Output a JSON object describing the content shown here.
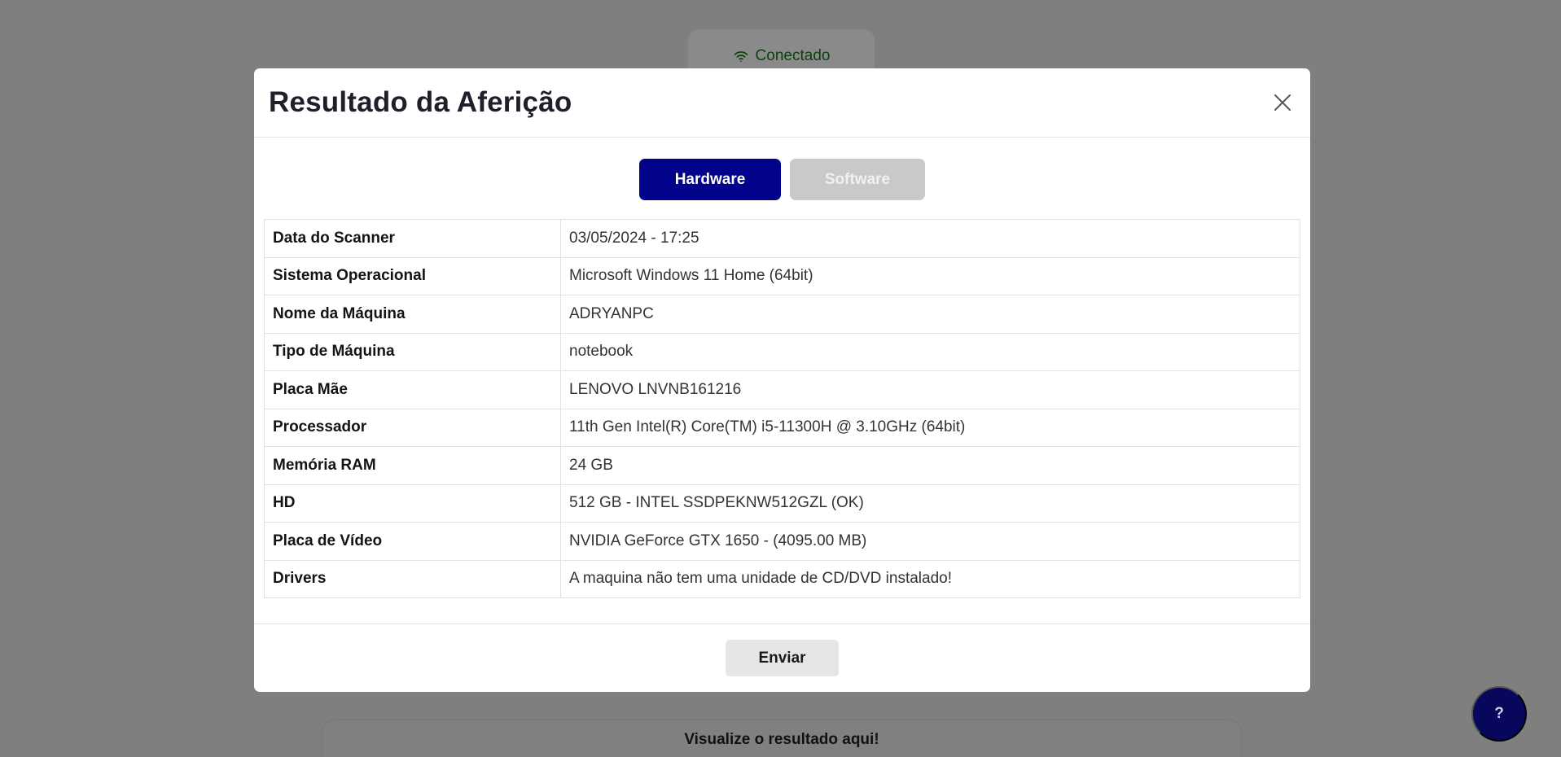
{
  "background": {
    "status_label": "Conectado",
    "status_icon": "wifi-icon",
    "result_heading": "Visualize o resultado aqui!",
    "help_label": "?"
  },
  "modal": {
    "title": "Resultado da Aferição",
    "close_icon": "close-icon",
    "tabs": [
      {
        "label": "Hardware",
        "active": true
      },
      {
        "label": "Software",
        "active": false
      }
    ],
    "rows": [
      {
        "label": "Data do Scanner",
        "value": "03/05/2024 - 17:25"
      },
      {
        "label": "Sistema Operacional",
        "value": "Microsoft Windows 11 Home (64bit)"
      },
      {
        "label": "Nome da Máquina",
        "value": "ADRYANPC"
      },
      {
        "label": "Tipo de Máquina",
        "value": "notebook"
      },
      {
        "label": "Placa Mãe",
        "value": "LENOVO LNVNB161216"
      },
      {
        "label": "Processador",
        "value": "11th Gen Intel(R) Core(TM) i5-11300H @ 3.10GHz (64bit)"
      },
      {
        "label": "Memória RAM",
        "value": "24 GB"
      },
      {
        "label": "HD",
        "value": "512 GB - INTEL SSDPEKNW512GZL (OK)"
      },
      {
        "label": "Placa de Vídeo",
        "value": "NVIDIA GeForce GTX 1650 - (4095.00 MB)"
      },
      {
        "label": "Drivers",
        "value": "A maquina não tem uma unidade de CD/DVD instalado!"
      }
    ],
    "send_label": "Enviar"
  },
  "colors": {
    "overlay": "#7f7f7f",
    "primary": "#02028a",
    "tab_inactive": "#c9c9c9",
    "help_button": "#07075c"
  }
}
